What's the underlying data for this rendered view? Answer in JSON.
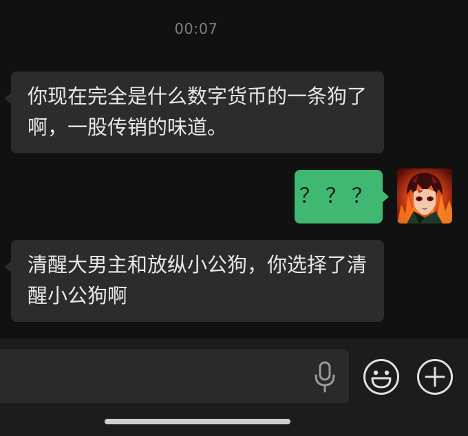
{
  "chat": {
    "timestamp": "00:07",
    "messages": [
      {
        "direction": "incoming",
        "text": "你现在完全是什么数字货币的一条狗了啊，一股传销的味道。"
      },
      {
        "direction": "outgoing",
        "text": "？？？"
      },
      {
        "direction": "incoming",
        "text": "清醒大男主和放纵小公狗，你选择了清醒小公狗啊"
      }
    ]
  },
  "input_bar": {
    "icons": [
      "microphone-icon",
      "emoji-icon",
      "plus-icon"
    ]
  },
  "colors": {
    "background": "#111111",
    "incoming_bubble": "#2c2c2c",
    "outgoing_bubble": "#3fb872",
    "timestamp": "#7d7d7d"
  }
}
